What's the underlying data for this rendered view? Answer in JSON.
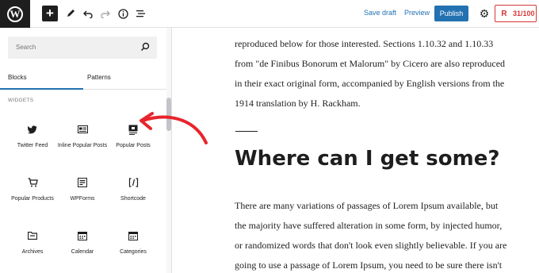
{
  "toolbar": {
    "wp_logo_letter": "W",
    "save_draft": "Save draft",
    "preview": "Preview",
    "publish": "Publish",
    "score": "31/100",
    "score_logo_letter": "R"
  },
  "inserter": {
    "search_placeholder": "Search",
    "tabs": [
      "Blocks",
      "Patterns"
    ],
    "active_tab": "Blocks",
    "section_title": "WIDGETS",
    "blocks": [
      {
        "label": "Twitter Feed",
        "icon": "twitter-icon"
      },
      {
        "label": "Inline Popular Posts",
        "icon": "inline-posts-icon"
      },
      {
        "label": "Popular Posts",
        "icon": "popular-posts-icon"
      },
      {
        "label": "Popular Products",
        "icon": "cart-icon"
      },
      {
        "label": "WPForms",
        "icon": "wpforms-icon"
      },
      {
        "label": "Shortcode",
        "icon": "shortcode-icon"
      },
      {
        "label": "Archives",
        "icon": "archive-folder-icon"
      },
      {
        "label": "Calendar",
        "icon": "calendar-icon"
      },
      {
        "label": "Categories",
        "icon": "categories-icon"
      }
    ]
  },
  "content": {
    "para1": [
      "reproduced below for those interested. Sections 1.10.32 and 1.10.33",
      "from \"de Finibus Bonorum et Malorum\" by Cicero are also reproduced",
      "in their exact original form, accompanied by English versions from the",
      "1914 translation by H. Rackham."
    ],
    "heading": "Where can I get some?",
    "para2": [
      "There are many variations of passages of Lorem Ipsum available, but",
      "the majority have suffered alteration in some form, by injected humor,",
      "or randomized words that don't look even slightly believable. If you are",
      "going to use a passage of Lorem Ipsum, you need to be sure there isn't"
    ]
  },
  "colors": {
    "accent": "#2271b1",
    "arrow": "#e8242c",
    "score": "#d63638"
  }
}
